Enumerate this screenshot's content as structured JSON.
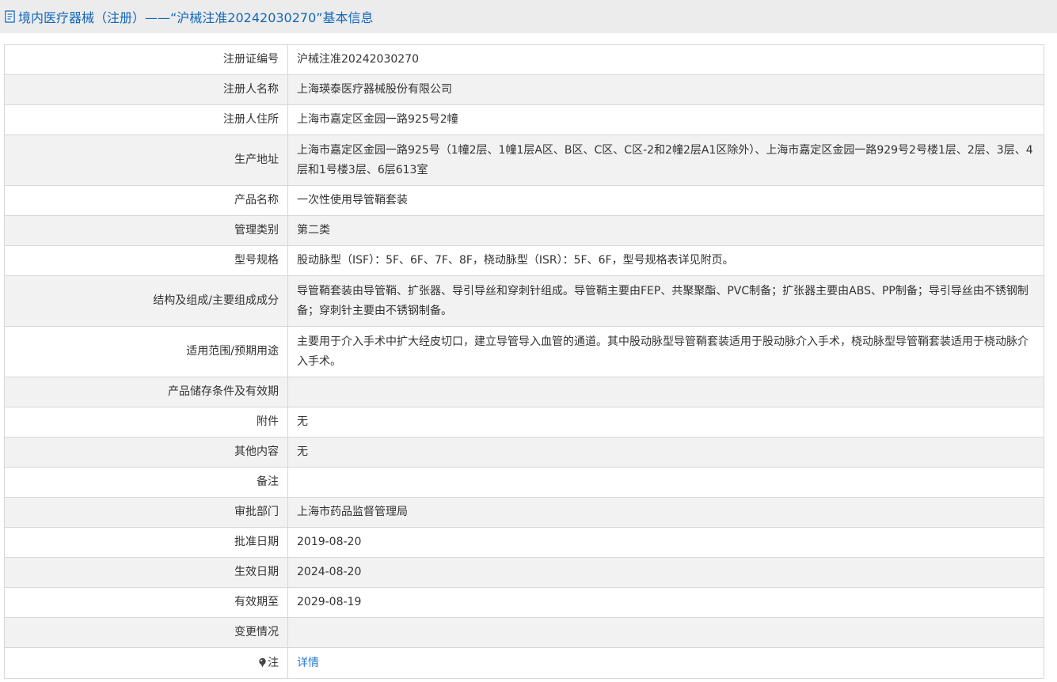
{
  "header": {
    "title": "境内医疗器械（注册）——“沪械注准20242030270”基本信息",
    "icon": "document-icon"
  },
  "colors": {
    "title": "#1166bb",
    "link": "#2b7bd3",
    "header_bg": "#ececec",
    "stripe": "#f2f2f2",
    "border": "#d7d7d7"
  },
  "rows": [
    {
      "label": "注册证编号",
      "value": "沪械注准20242030270"
    },
    {
      "label": "注册人名称",
      "value": "上海瑛泰医疗器械股份有限公司"
    },
    {
      "label": "注册人住所",
      "value": "上海市嘉定区金园一路925号2幢"
    },
    {
      "label": "生产地址",
      "value": "上海市嘉定区金园一路925号（1幢2层、1幢1层A区、B区、C区、C区-2和2幢2层A1区除外）、上海市嘉定区金园一路929号2号楼1层、2层、3层、4层和1号楼3层、6层613室"
    },
    {
      "label": "产品名称",
      "value": "一次性使用导管鞘套装"
    },
    {
      "label": "管理类别",
      "value": "第二类"
    },
    {
      "label": "型号规格",
      "value": "股动脉型（ISF）：5F、6F、7F、8F，桡动脉型（ISR）：5F、6F，型号规格表详见附页。"
    },
    {
      "label": "结构及组成/主要组成成分",
      "value": "导管鞘套装由导管鞘、扩张器、导引导丝和穿刺针组成。导管鞘主要由FEP、共聚聚酯、PVC制备；扩张器主要由ABS、PP制备；导引导丝由不锈钢制备；穿刺针主要由不锈钢制备。"
    },
    {
      "label": "适用范围/预期用途",
      "value": "主要用于介入手术中扩大经皮切口，建立导管导入血管的通道。其中股动脉型导管鞘套装适用于股动脉介入手术，桡动脉型导管鞘套装适用于桡动脉介入手术。"
    },
    {
      "label": "产品储存条件及有效期",
      "value": ""
    },
    {
      "label": "附件",
      "value": "无"
    },
    {
      "label": "其他内容",
      "value": "无"
    },
    {
      "label": "备注",
      "value": ""
    },
    {
      "label": "审批部门",
      "value": "上海市药品监督管理局"
    },
    {
      "label": "批准日期",
      "value": "2019-08-20"
    },
    {
      "label": "生效日期",
      "value": "2024-08-20"
    },
    {
      "label": "有效期至",
      "value": "2029-08-19"
    },
    {
      "label": "变更情况",
      "value": ""
    }
  ],
  "note_row": {
    "label": "注",
    "icon": "pin-icon",
    "link": "详情"
  }
}
